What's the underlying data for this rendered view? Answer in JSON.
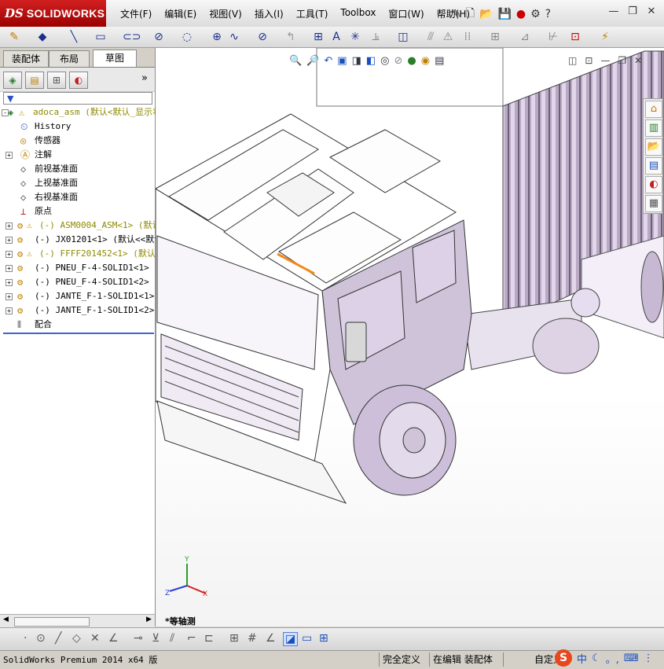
{
  "app": {
    "brand": "SOLIDWORKS",
    "logo_prefix": "DS"
  },
  "menu": {
    "items": [
      "文件(F)",
      "编辑(E)",
      "视图(V)",
      "插入(I)",
      "工具(T)",
      "Toolbox",
      "窗口(W)",
      "帮助(H)"
    ]
  },
  "panel": {
    "tabs": [
      "装配体",
      "布局",
      "草图"
    ],
    "active_tab": "草图",
    "tree": [
      {
        "label": "adoca_asm  (默认<默认_显示状",
        "icon": "assembly-warning-icon",
        "color": "yellow",
        "expand": "-",
        "level": 0
      },
      {
        "label": "History",
        "icon": "history-icon",
        "level": 1
      },
      {
        "label": "传感器",
        "icon": "sensor-icon",
        "level": 1
      },
      {
        "label": "注解",
        "icon": "annotation-icon",
        "expand": "+",
        "level": 1
      },
      {
        "label": "前视基准面",
        "icon": "plane-icon",
        "level": 1
      },
      {
        "label": "上视基准面",
        "icon": "plane-icon",
        "level": 1
      },
      {
        "label": "右视基准面",
        "icon": "plane-icon",
        "level": 1
      },
      {
        "label": "原点",
        "icon": "origin-icon",
        "level": 1
      },
      {
        "label": "(-) ASM0004_ASM<1> (默认",
        "icon": "subassembly-warning-icon",
        "color": "yellow",
        "expand": "+",
        "level": 1
      },
      {
        "label": "(-) JX01201<1> (默认<<默认",
        "icon": "part-icon",
        "expand": "+",
        "level": 1
      },
      {
        "label": "(-) FFFF201452<1> (默认",
        "icon": "subassembly-warning-icon",
        "color": "yellow",
        "expand": "+",
        "level": 1
      },
      {
        "label": "(-) PNEU_F-4-SOLID1<1> (默",
        "icon": "part-icon",
        "expand": "+",
        "level": 1
      },
      {
        "label": "(-) PNEU_F-4-SOLID1<2> (默",
        "icon": "part-icon",
        "expand": "+",
        "level": 1
      },
      {
        "label": "(-) JANTE_F-1-SOLID1<1> (默",
        "icon": "part-icon",
        "expand": "+",
        "level": 1
      },
      {
        "label": "(-) JANTE_F-1-SOLID1<2> (默",
        "icon": "part-icon",
        "expand": "+",
        "level": 1
      },
      {
        "label": "配合",
        "icon": "mates-icon",
        "level": 1
      }
    ]
  },
  "graphics": {
    "view_label": "*等轴测",
    "triad": {
      "x": "X",
      "y": "Y",
      "z": "Z"
    }
  },
  "status": {
    "app_version": "SolidWorks Premium 2014 x64 版",
    "definition": "完全定义",
    "mode": "在编辑 装配体",
    "custom": "自定义"
  },
  "ime": {
    "logo": "S",
    "lang": "中",
    "punct": "。,"
  },
  "colors": {
    "brand_red": "#c0141b",
    "truck_body": "#d9cfe0",
    "tree_selected_line": "#3c67c9"
  }
}
